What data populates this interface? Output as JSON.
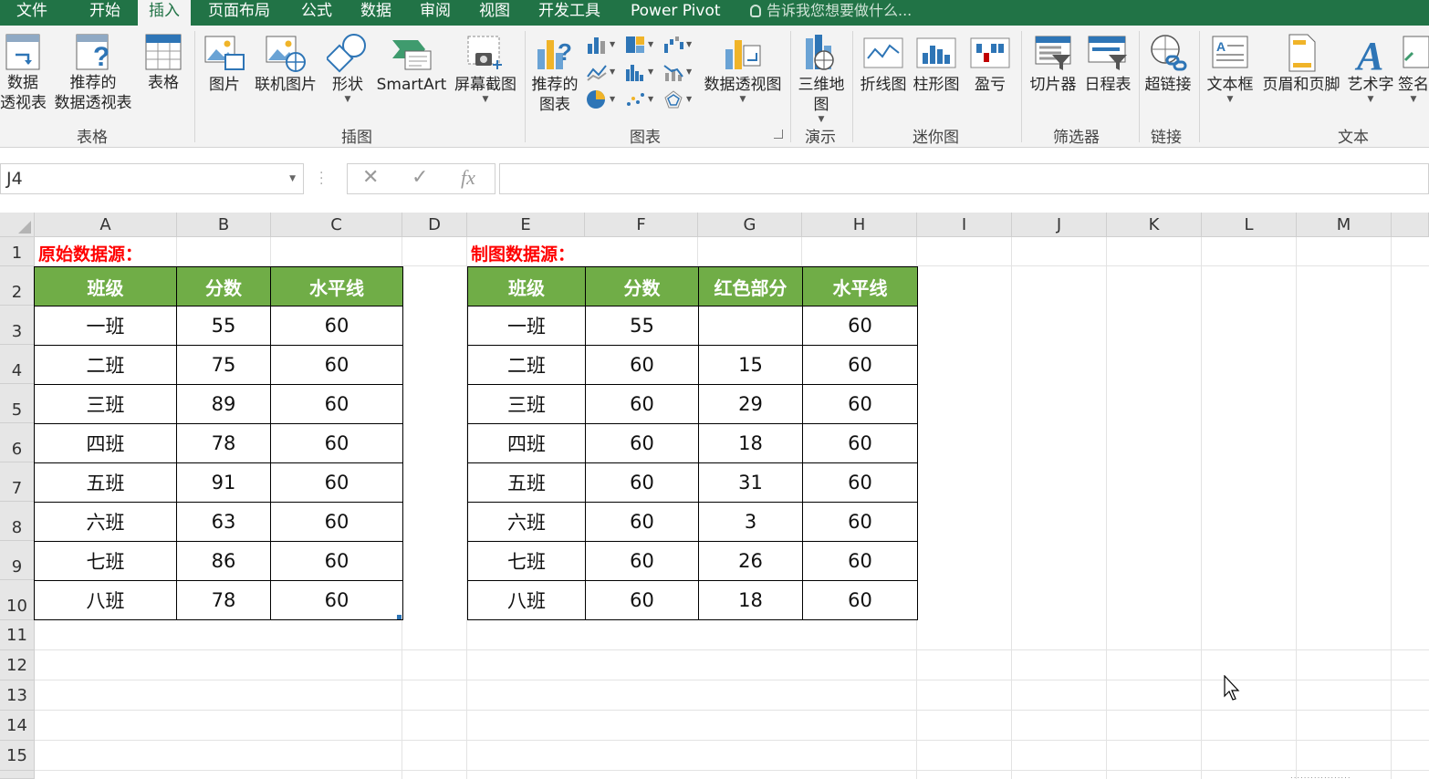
{
  "ribbon_tabs": [
    "文件",
    "开始",
    "插入",
    "页面布局",
    "公式",
    "数据",
    "审阅",
    "视图",
    "开发工具",
    "Power Pivot"
  ],
  "active_tab": "插入",
  "tell_me": "告诉我您想要做什么...",
  "groups": {
    "tables": {
      "label": "表格",
      "items": [
        {
          "l1": "数据",
          "l2": "透视表"
        },
        {
          "l1": "推荐的",
          "l2": "数据透视表"
        },
        {
          "l1": "表格",
          "l2": ""
        }
      ]
    },
    "illustrations": {
      "label": "插图",
      "items": [
        "图片",
        "联机图片",
        "形状",
        "SmartArt",
        "屏幕截图"
      ]
    },
    "charts": {
      "label": "图表",
      "recommended": {
        "l1": "推荐的",
        "l2": "图表"
      },
      "pivot_chart": "数据透视图"
    },
    "tours": {
      "label": "演示",
      "map": {
        "l1": "三维地",
        "l2": "图"
      }
    },
    "sparklines": {
      "label": "迷你图",
      "items": [
        "折线图",
        "柱形图",
        "盈亏"
      ]
    },
    "filters": {
      "label": "筛选器",
      "items": [
        "切片器",
        "日程表"
      ]
    },
    "links": {
      "label": "链接",
      "items": [
        "超链接"
      ]
    },
    "text": {
      "label": "文本",
      "items": [
        "文本框",
        "页眉和页脚",
        "艺术字",
        "签名"
      ]
    }
  },
  "formula_bar": {
    "name_box": "J4",
    "cancel": "✕",
    "enter": "✓",
    "fx": "fx",
    "formula": ""
  },
  "columns": [
    "A",
    "B",
    "C",
    "D",
    "E",
    "F",
    "G",
    "H",
    "I",
    "J",
    "K",
    "L",
    "M"
  ],
  "rows": [
    "1",
    "2",
    "3",
    "4",
    "5",
    "6",
    "7",
    "8",
    "9",
    "10",
    "11",
    "12",
    "13",
    "14",
    "15"
  ],
  "source_title": "原始数据源：",
  "chart_source_title": "制图数据源：",
  "table1": {
    "headers": [
      "班级",
      "分数",
      "水平线"
    ],
    "rows": [
      [
        "一班",
        "55",
        "60"
      ],
      [
        "二班",
        "75",
        "60"
      ],
      [
        "三班",
        "89",
        "60"
      ],
      [
        "四班",
        "78",
        "60"
      ],
      [
        "五班",
        "91",
        "60"
      ],
      [
        "六班",
        "63",
        "60"
      ],
      [
        "七班",
        "86",
        "60"
      ],
      [
        "八班",
        "78",
        "60"
      ]
    ]
  },
  "table2": {
    "headers": [
      "班级",
      "分数",
      "红色部分",
      "水平线"
    ],
    "rows": [
      [
        "一班",
        "55",
        "",
        "60"
      ],
      [
        "二班",
        "60",
        "15",
        "60"
      ],
      [
        "三班",
        "60",
        "29",
        "60"
      ],
      [
        "四班",
        "60",
        "18",
        "60"
      ],
      [
        "五班",
        "60",
        "31",
        "60"
      ],
      [
        "六班",
        "60",
        "3",
        "60"
      ],
      [
        "七班",
        "60",
        "26",
        "60"
      ],
      [
        "八班",
        "60",
        "18",
        "60"
      ]
    ]
  },
  "colors": {
    "brand": "#217346",
    "header_fill": "#70ad47",
    "title_red": "#ff0000"
  }
}
